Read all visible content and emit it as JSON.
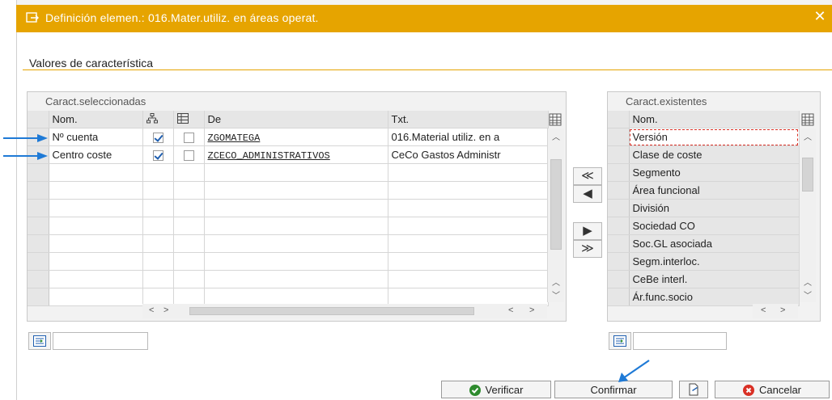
{
  "dialog": {
    "title": "Definición elemen.: 016.Mater.utiliz. en áreas operat.",
    "close_glyph": "✕"
  },
  "section": {
    "title": "Valores de característica"
  },
  "selected_panel": {
    "title": "Caract.seleccionadas",
    "columns": [
      "Nom.",
      "",
      "",
      "De",
      "Txt."
    ],
    "rows": [
      {
        "name": "Nº cuenta",
        "check1": true,
        "check2": false,
        "from": "ZGOMATEGA",
        "text": "016.Material utiliz. en a"
      },
      {
        "name": "Centro coste",
        "check1": true,
        "check2": false,
        "from": "ZCECO_ADMINISTRATIVOS",
        "text": "CeCo Gastos Administr"
      }
    ],
    "empty_rows": 8
  },
  "existing_panel": {
    "title": "Caract.existentes",
    "column": "Nom.",
    "items": [
      "Versión",
      "Clase de coste",
      "Segmento",
      "Área funcional",
      "División",
      "Sociedad CO",
      "Soc.GL asociada",
      "Segm.interloc.",
      "CeBe interl.",
      "Ár.func.socio"
    ]
  },
  "move_buttons": {
    "all_left": "≪",
    "left": "◀",
    "right": "▶",
    "all_right": "≫"
  },
  "footer": {
    "verify": "Verificar",
    "confirm": "Confirmar",
    "cancel": "Cancelar"
  },
  "colors": {
    "titlebar": "#e6a400",
    "accent_blue": "#1f7ad6",
    "verify_green": "#2e8b2e",
    "cancel_red": "#d93025"
  },
  "icons": [
    "dialog-icon",
    "close-icon",
    "hierarchy-icon",
    "interval-icon",
    "settings-icon",
    "filter-icon",
    "check-circle-icon",
    "save-icon",
    "cancel-circle-icon"
  ]
}
